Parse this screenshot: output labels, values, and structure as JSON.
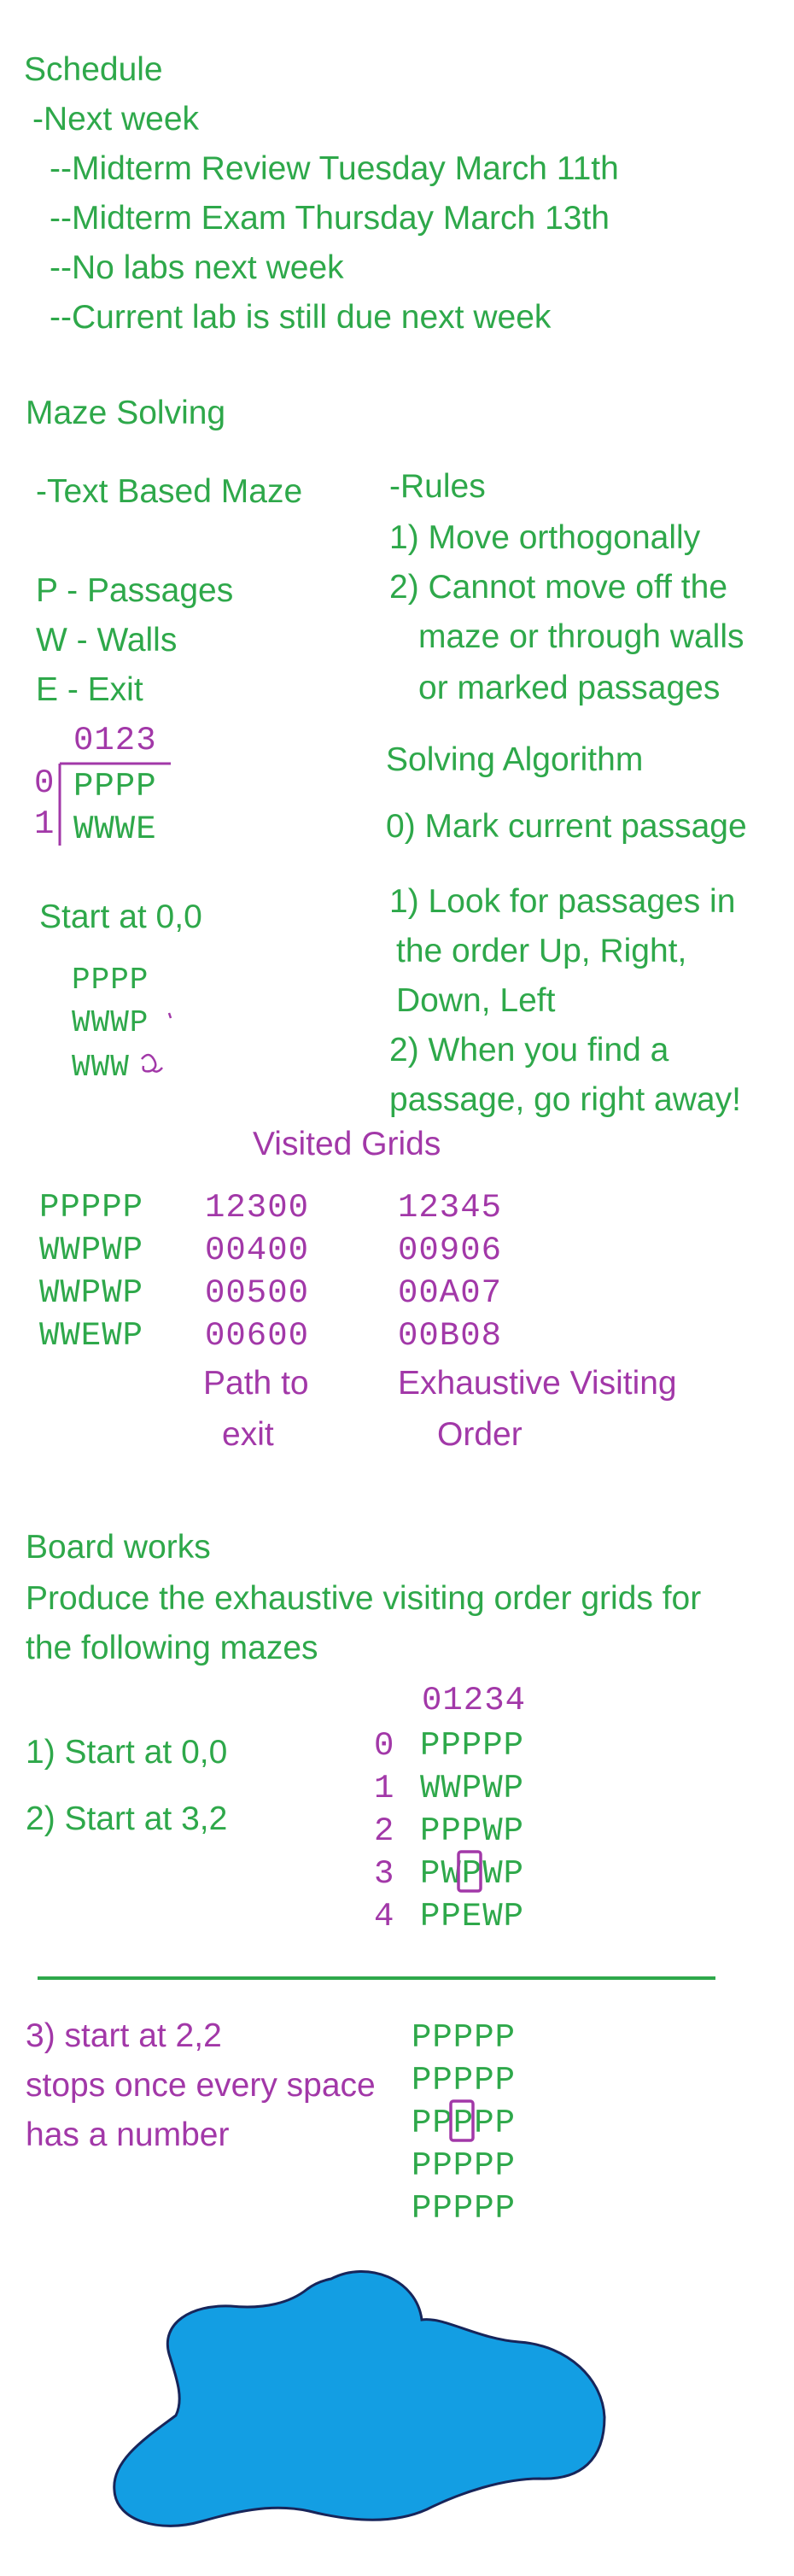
{
  "colors": {
    "green": "#2ea84a",
    "purple": "#a238a8",
    "blob": "#139ee3"
  },
  "schedule": {
    "heading": "Schedule",
    "next_week": "-Next week",
    "items": [
      "--Midterm Review Tuesday March 11th",
      "--Midterm Exam Thursday March 13th",
      "--No labs next week",
      "--Current lab is still due next week"
    ]
  },
  "maze_solving": {
    "heading": "Maze Solving",
    "text_based": "-Text Based Maze",
    "legend": [
      "P - Passages",
      "W - Walls",
      "E - Exit"
    ],
    "rules_heading": "-Rules",
    "rules": [
      "1) Move orthogonally",
      "2) Cannot move off the",
      "maze or through walls",
      "or marked passages"
    ],
    "small_maze": {
      "col_header": "0123",
      "row_labels": [
        "0",
        "1"
      ],
      "rows": [
        "PPPP",
        "WWWE"
      ]
    },
    "algorithm_heading": "Solving Algorithm",
    "algorithm": [
      "0) Mark current passage",
      "1) Look for passages in",
      "the order Up, Right,",
      "Down, Left",
      "2) When you find a",
      "passage, go right away!"
    ],
    "start_label": "Start at 0,0",
    "sketch_rows": [
      "PPPP",
      "WWWP",
      "WWW"
    ]
  },
  "visited": {
    "heading": "Visited Grids",
    "maze": [
      "PPPPP",
      "WWPWP",
      "WWPWP",
      "WWEWP"
    ],
    "path": [
      "12300",
      "00400",
      "00500",
      "00600"
    ],
    "exhaustive": [
      "12345",
      "00906",
      "00A07",
      "00B08"
    ],
    "path_caption": [
      "Path to",
      "exit"
    ],
    "exhaustive_caption": [
      "Exhaustive Visiting",
      "Order"
    ]
  },
  "board_works": {
    "heading": "Board works",
    "prompt": [
      "Produce the exhaustive visiting order grids for",
      "the following mazes"
    ],
    "tasks": [
      "1) Start at 0,0",
      "2) Start at 3,2"
    ],
    "maze": {
      "col_header": "01234",
      "row_labels": [
        "0",
        "1",
        "2",
        "3",
        "4"
      ],
      "rows": [
        "PPPPP",
        "WWPWP",
        "PPPWP",
        "PWPWP",
        "PPEWP"
      ]
    },
    "task3": [
      "3) start at 2,2",
      "stops once every space",
      "has a number"
    ],
    "maze3": [
      "PPPPP",
      "PPPPP",
      "PPPPP",
      "PPPPP",
      "PPPPP"
    ]
  }
}
